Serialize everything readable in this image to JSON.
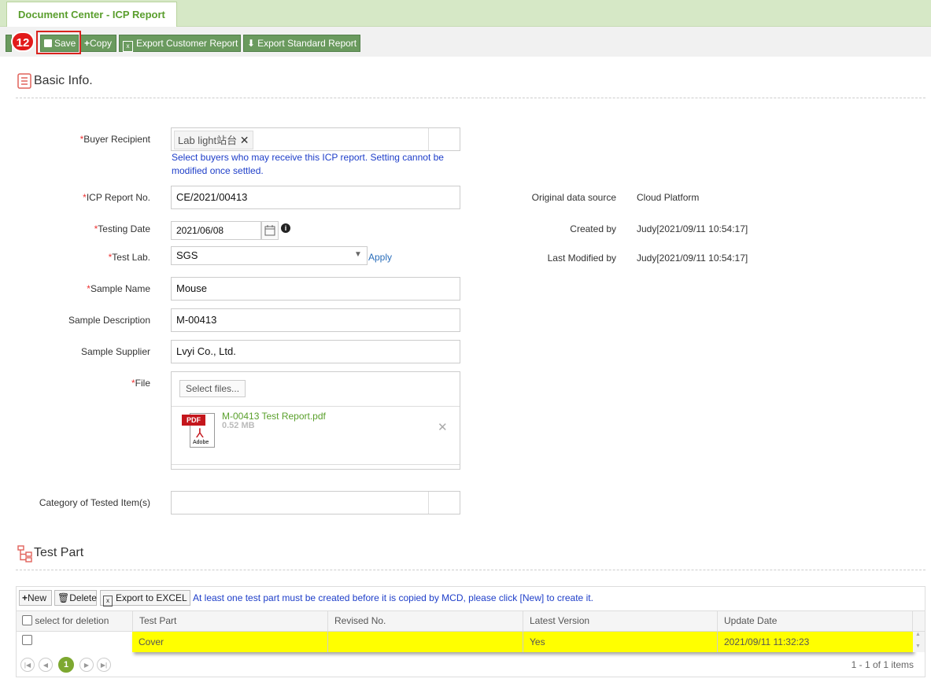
{
  "tab": {
    "title": "Document Center - ICP Report"
  },
  "toolbar": {
    "save": "Save",
    "copy": "Copy",
    "export_customer": "Export Customer Report",
    "export_standard": "Export Standard Report",
    "step_badge": "12"
  },
  "basic_info": {
    "title": "Basic Info.",
    "buyer_recipient_label": "Buyer Recipient",
    "buyer_tag": "Lab light站台",
    "buyer_hint": "Select buyers who may receive this ICP report. Setting cannot be modified once settled.",
    "icp_no_label": "ICP Report No.",
    "icp_no_value": "CE/2021/00413",
    "testing_date_label": "Testing Date",
    "testing_date_value": "2021/06/08",
    "test_lab_label": "Test Lab.",
    "test_lab_value": "SGS",
    "apply_link": "Apply",
    "sample_name_label": "Sample Name",
    "sample_name_value": "Mouse",
    "sample_desc_label": "Sample Description",
    "sample_desc_value": "M-00413",
    "sample_supplier_label": "Sample Supplier",
    "sample_supplier_value": "Lvyi Co., Ltd.",
    "file_label": "File",
    "select_files": "Select files...",
    "file_name": "M-00413 Test Report.pdf",
    "file_size": "0.52 MB",
    "pdf_text": "PDF",
    "adobe_text": "Adobe",
    "category_label": "Category of Tested Item(s)",
    "required_mark": "*",
    "original_source_label": "Original data source",
    "original_source_value": "Cloud Platform",
    "created_by_label": "Created by",
    "created_by_value": "Judy[2021/09/11 10:54:17]",
    "last_modified_label": "Last Modified by",
    "last_modified_value": "Judy[2021/09/11 10:54:17]"
  },
  "test_part": {
    "title": "Test Part",
    "new_btn": "New",
    "delete_btn": "Delete",
    "export_btn": "Export to EXCEL",
    "notice": "At least one test part must be created before it is copied by MCD, please click [New] to create it.",
    "columns": [
      "select for deletion",
      "Test Part",
      "Revised No.",
      "Latest Version",
      "Update Date"
    ],
    "rows": [
      {
        "test_part": "Cover",
        "revised_no": "",
        "latest_version": "Yes",
        "update_date": "2021/09/11 11:32:23"
      }
    ],
    "page": "1",
    "items_text": "1 - 1 of 1 items"
  }
}
